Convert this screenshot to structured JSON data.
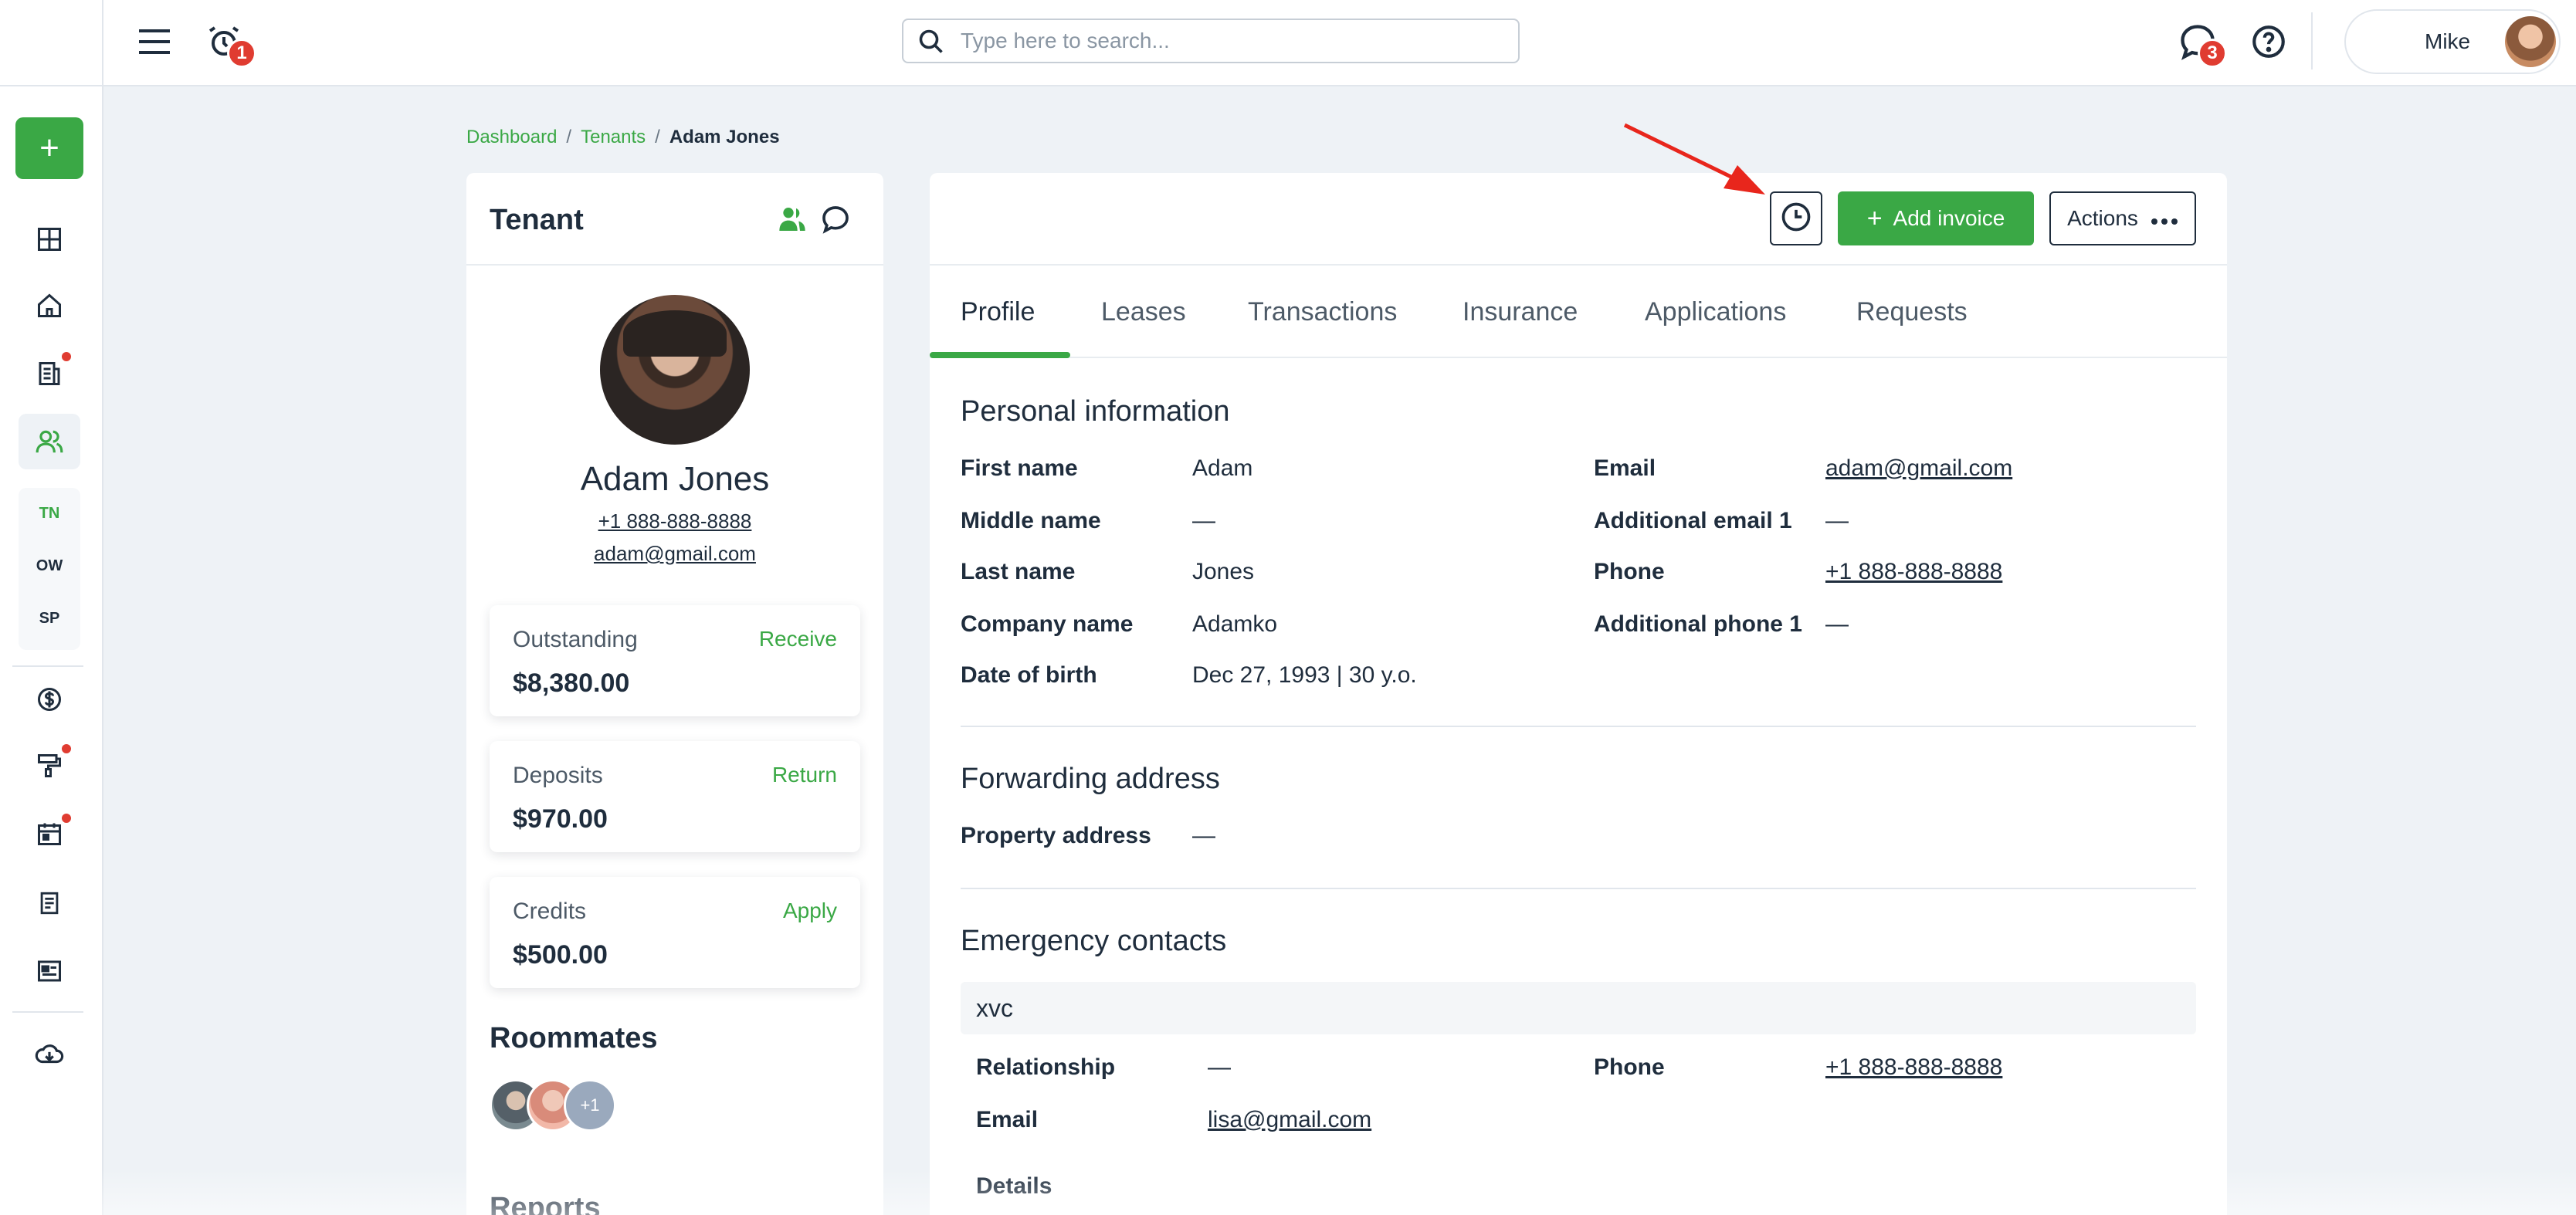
{
  "topbar": {
    "notification_count": "1",
    "messages_count": "3",
    "search_placeholder": "Type here to search...",
    "user_name": "Mike"
  },
  "sidebar": {
    "add_label": "+",
    "sub_items": [
      "TN",
      "OW",
      "SP"
    ]
  },
  "breadcrumb": {
    "items": [
      "Dashboard",
      "Tenants"
    ],
    "current": "Adam Jones",
    "separator": "/"
  },
  "tenant_card": {
    "title": "Tenant",
    "name": "Adam Jones",
    "phone": "+1 888-888-8888",
    "email": "adam@gmail.com",
    "stats": [
      {
        "label": "Outstanding",
        "action": "Receive",
        "value": "$8,380.00"
      },
      {
        "label": "Deposits",
        "action": "Return",
        "value": "$970.00"
      },
      {
        "label": "Credits",
        "action": "Apply",
        "value": "$500.00"
      }
    ],
    "roommates_title": "Roommates",
    "roommates_more": "+1",
    "reports_title": "Reports"
  },
  "main": {
    "add_invoice_label": "Add invoice",
    "actions_label": "Actions",
    "tabs": [
      "Profile",
      "Leases",
      "Transactions",
      "Insurance",
      "Applications",
      "Requests"
    ],
    "personal": {
      "title": "Personal information",
      "left": [
        {
          "label": "First name",
          "value": "Adam"
        },
        {
          "label": "Middle name",
          "value": "—"
        },
        {
          "label": "Last name",
          "value": "Jones"
        },
        {
          "label": "Company name",
          "value": "Adamko"
        },
        {
          "label": "Date of birth",
          "value": "Dec 27, 1993 | 30 y.o."
        }
      ],
      "right": [
        {
          "label": "Email",
          "value": "adam@gmail.com"
        },
        {
          "label": "Additional email 1",
          "value": "—"
        },
        {
          "label": "Phone",
          "value": "+1 888-888-8888"
        },
        {
          "label": "Additional phone 1",
          "value": "—"
        }
      ]
    },
    "forwarding": {
      "title": "Forwarding address",
      "label": "Property address",
      "value": "—"
    },
    "emergency": {
      "title": "Emergency contacts",
      "contact_name": "xvc",
      "relationship_label": "Relationship",
      "relationship_value": "—",
      "phone_label": "Phone",
      "phone_value": "+1 888-888-8888",
      "email_label": "Email",
      "email_value": "lisa@gmail.com",
      "details_label": "Details"
    }
  },
  "colors": {
    "accent": "#3aa845",
    "badge": "#e03c31",
    "text": "#1f2d3d",
    "annotation_arrow": "#e8261c"
  }
}
